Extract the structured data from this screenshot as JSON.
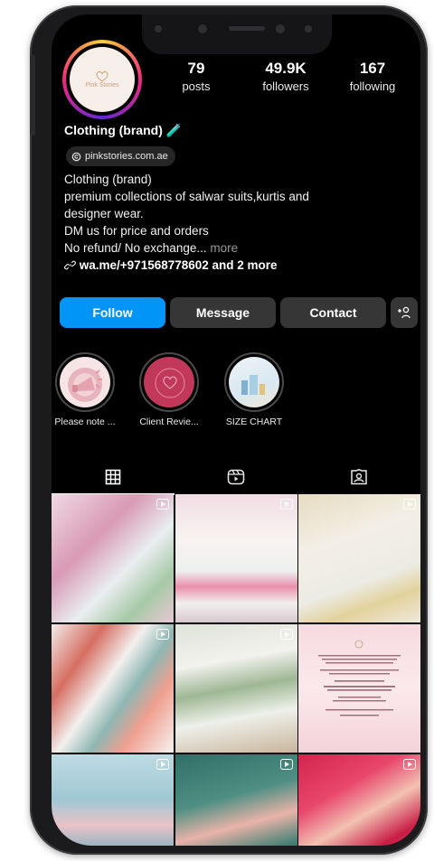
{
  "profile": {
    "name": "Clothing (brand)",
    "verified_symbol": "🧪",
    "link_chip": "pinkstories.com.ae",
    "avatar_text": "Pink Stories"
  },
  "stats": {
    "posts": {
      "value": "79",
      "label": "posts"
    },
    "followers": {
      "value": "49.9K",
      "label": "followers"
    },
    "following": {
      "value": "167",
      "label": "following"
    }
  },
  "bio": {
    "line1": "Clothing (brand)",
    "line2": "premium collections of salwar suits,kurtis and",
    "line3": "designer wear.",
    "line4": "DM us for price and orders",
    "line5": "No refund/ No exchange...",
    "more": " more",
    "link": "wa.me/+971568778602 and 2 more"
  },
  "buttons": {
    "follow": "Follow",
    "message": "Message",
    "contact": "Contact",
    "add_user": "+ዶ"
  },
  "highlights": [
    {
      "label": "Please note ..."
    },
    {
      "label": "Client Revie..."
    },
    {
      "label": "SIZE CHART"
    }
  ],
  "tabs": [
    "grid-icon",
    "reels-icon",
    "tagged-icon"
  ],
  "colors": {
    "accent": "#0095f6",
    "background": "#000000",
    "button": "#363636"
  }
}
